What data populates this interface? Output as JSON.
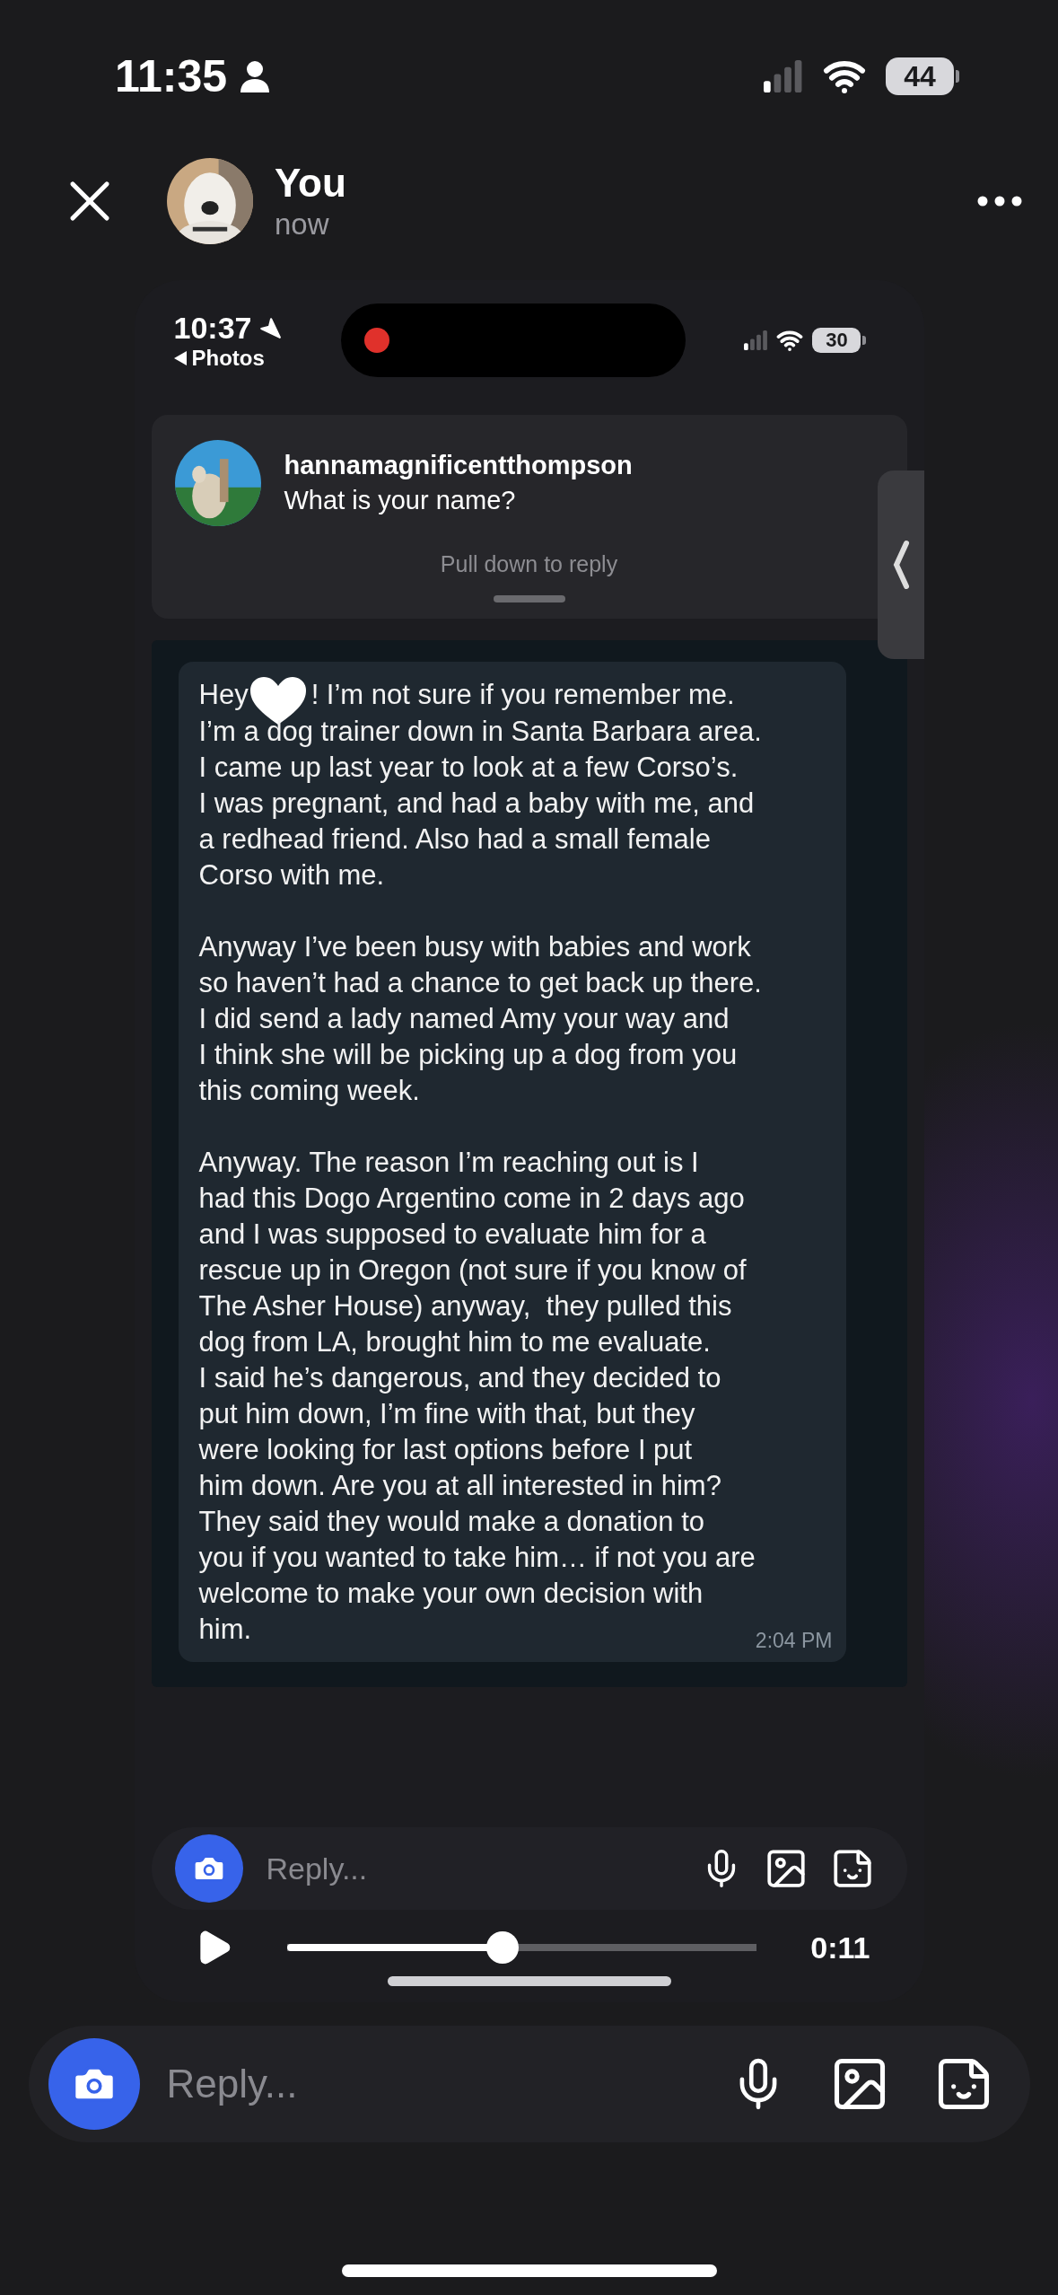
{
  "status_bar": {
    "time": "11:35",
    "battery": "44"
  },
  "header": {
    "name": "You",
    "time": "now"
  },
  "screenshot": {
    "status_bar": {
      "time": "10:37",
      "back_label": "Photos",
      "battery": "30"
    },
    "notification": {
      "username": "hannamagnificentthompson",
      "message": "What is your name?",
      "hint": "Pull down to reply"
    },
    "message": {
      "greeting": "Hey",
      "greeting_rest": "! I’m not sure if you remember me.",
      "paragraphs": [
        "I’m a dog trainer down in Santa Barbara area.\nI came up last year to look at a few Corso’s.\nI was pregnant, and had a baby with me, and\na redhead friend. Also had a small female\nCorso with me.",
        "Anyway I’ve been busy with babies and work\nso haven’t had a chance to get back up there.\nI did send a lady named Amy your way and\nI think she will be picking up a dog from you\nthis coming week.",
        "Anyway. The reason I’m reaching out is I\nhad this Dogo Argentino come in 2 days ago\nand I was supposed to evaluate him for a\nrescue up in Oregon (not sure if you know of\nThe Asher House) anyway,  they pulled this\ndog from LA, brought him to me evaluate.\nI said he’s dangerous, and they decided to\nput him down, I’m fine with that, but they\nwere looking for last options before I put\nhim down. Are you at all interested in him?\nThey said they would make a donation to\nyou if you wanted to take him… if not you are\nwelcome to make your own decision with\nhim."
      ],
      "time": "2:04 PM"
    },
    "reply": {
      "placeholder": "Reply..."
    },
    "player": {
      "level": 0.46,
      "time": "0:11"
    }
  },
  "reply": {
    "placeholder": "Reply..."
  }
}
